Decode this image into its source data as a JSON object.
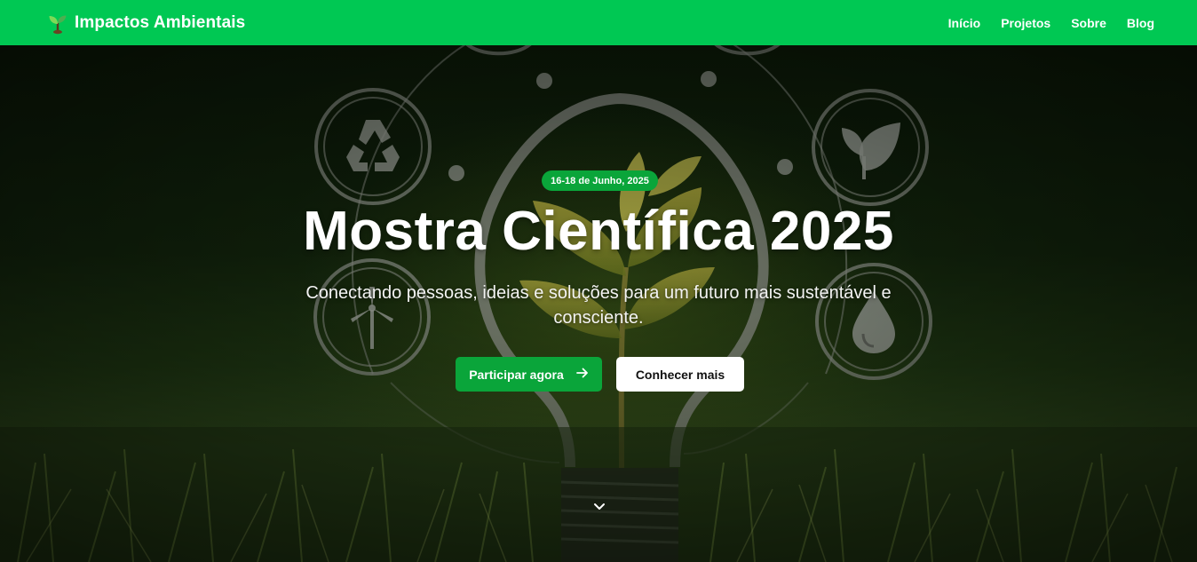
{
  "navbar": {
    "brand": "Impactos Ambientais",
    "brand_icon": "sprout-icon",
    "links": [
      "Início",
      "Projetos",
      "Sobre",
      "Blog"
    ],
    "background": "#00c853"
  },
  "hero": {
    "badge": "16-18 de Junho, 2025",
    "title": "Mostra Científica 2025",
    "subtitle": "Conectando pessoas, ideias e soluções para um futuro mais sustentável e consciente.",
    "primary_button": "Participar agora",
    "primary_button_icon": "arrow-right-icon",
    "secondary_button": "Conhecer mais",
    "scroll_icon": "chevron-down-icon",
    "accent_color": "#0aa53a",
    "background_icons": [
      "recycle-icon",
      "leaf-icon",
      "wind-turbine-icon",
      "water-drop-icon",
      "light-bulb-icon",
      "plant-icon"
    ]
  }
}
